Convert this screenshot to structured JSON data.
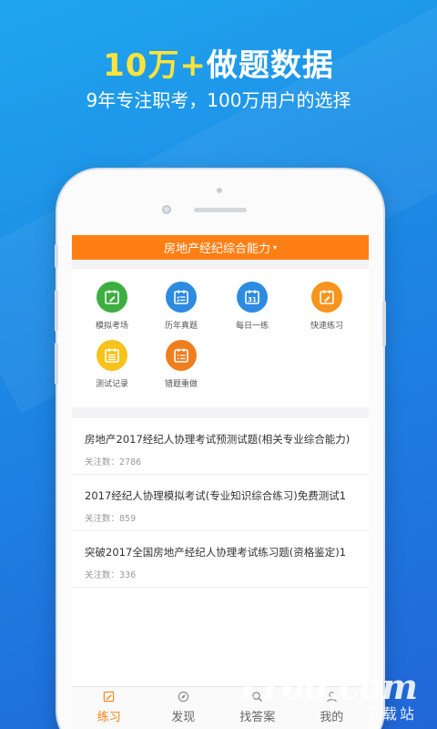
{
  "promo": {
    "headline_highlight": "10万+",
    "headline_rest": "做题数据",
    "subline": "9年专注职考，100万用户的选择"
  },
  "app": {
    "title": "房地产经纪综合能力",
    "title_caret": "▾",
    "grid_items": [
      {
        "label": "模拟考场",
        "icon": "calendar-edit-icon",
        "color": "#3dae3f"
      },
      {
        "label": "历年真题",
        "icon": "checklist-icon",
        "color": "#2d8be0"
      },
      {
        "label": "每日一练",
        "icon": "calendar-31-icon",
        "color": "#2d8be0"
      },
      {
        "label": "快速练习",
        "icon": "calendar-edit-icon",
        "color": "#f7941d"
      },
      {
        "label": "测试记录",
        "icon": "list-icon",
        "color": "#f7c21b"
      },
      {
        "label": "错题重做",
        "icon": "checklist-icon",
        "color": "#f07d1e"
      }
    ],
    "list_items": [
      {
        "title": "房地产2017经纪人协理考试预测试题(相关专业综合能力)",
        "count": "关注数：2786"
      },
      {
        "title": "2017经纪人协理模拟考试(专业知识综合练习)免费测试1",
        "count": "关注数：859"
      },
      {
        "title": "突破2017全国房地产经纪人协理考试练习题(资格鉴定)1",
        "count": "关注数：336"
      }
    ],
    "tabs": [
      {
        "label": "练习",
        "icon": "pencil-icon",
        "active": true
      },
      {
        "label": "发现",
        "icon": "compass-icon",
        "active": false
      },
      {
        "label": "找答案",
        "icon": "search-icon",
        "active": false
      },
      {
        "label": "我的",
        "icon": "person-icon",
        "active": false
      }
    ]
  },
  "watermark": {
    "logo": "116d.com",
    "sub": "下载站"
  },
  "colors": {
    "accent": "#ff7f14",
    "background": "#1d86e4",
    "headline_highlight": "#ffe33a"
  }
}
